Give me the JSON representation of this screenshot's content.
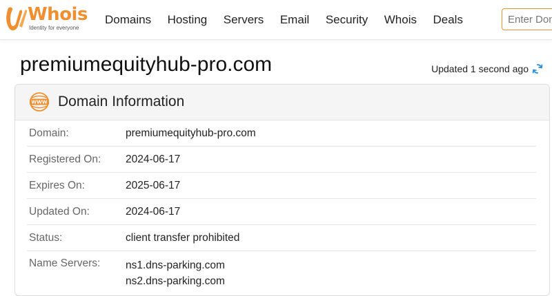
{
  "header": {
    "logo_text": "Whois",
    "logo_tagline": "Identity for everyone",
    "nav": [
      "Domains",
      "Hosting",
      "Servers",
      "Email",
      "Security",
      "Whois",
      "Deals"
    ],
    "search_placeholder": "Enter Domain"
  },
  "page": {
    "title": "premiumequityhub-pro.com",
    "updated_text": "Updated 1 second ago"
  },
  "card": {
    "title": "Domain Information",
    "icon_text": "WWW",
    "rows": [
      {
        "label": "Domain:",
        "value": "premiumequityhub-pro.com"
      },
      {
        "label": "Registered On:",
        "value": "2024-06-17"
      },
      {
        "label": "Expires On:",
        "value": "2025-06-17"
      },
      {
        "label": "Updated On:",
        "value": "2024-06-17"
      },
      {
        "label": "Status:",
        "value": "client transfer prohibited"
      }
    ],
    "name_servers": {
      "label": "Name Servers:",
      "values": [
        "ns1.dns-parking.com",
        "ns2.dns-parking.com"
      ]
    }
  },
  "colors": {
    "brand_orange": "#ef8f2f",
    "refresh_blue": "#2d8fe0"
  },
  "icons": [
    "whois-logo-icon",
    "refresh-icon",
    "www-icon"
  ]
}
